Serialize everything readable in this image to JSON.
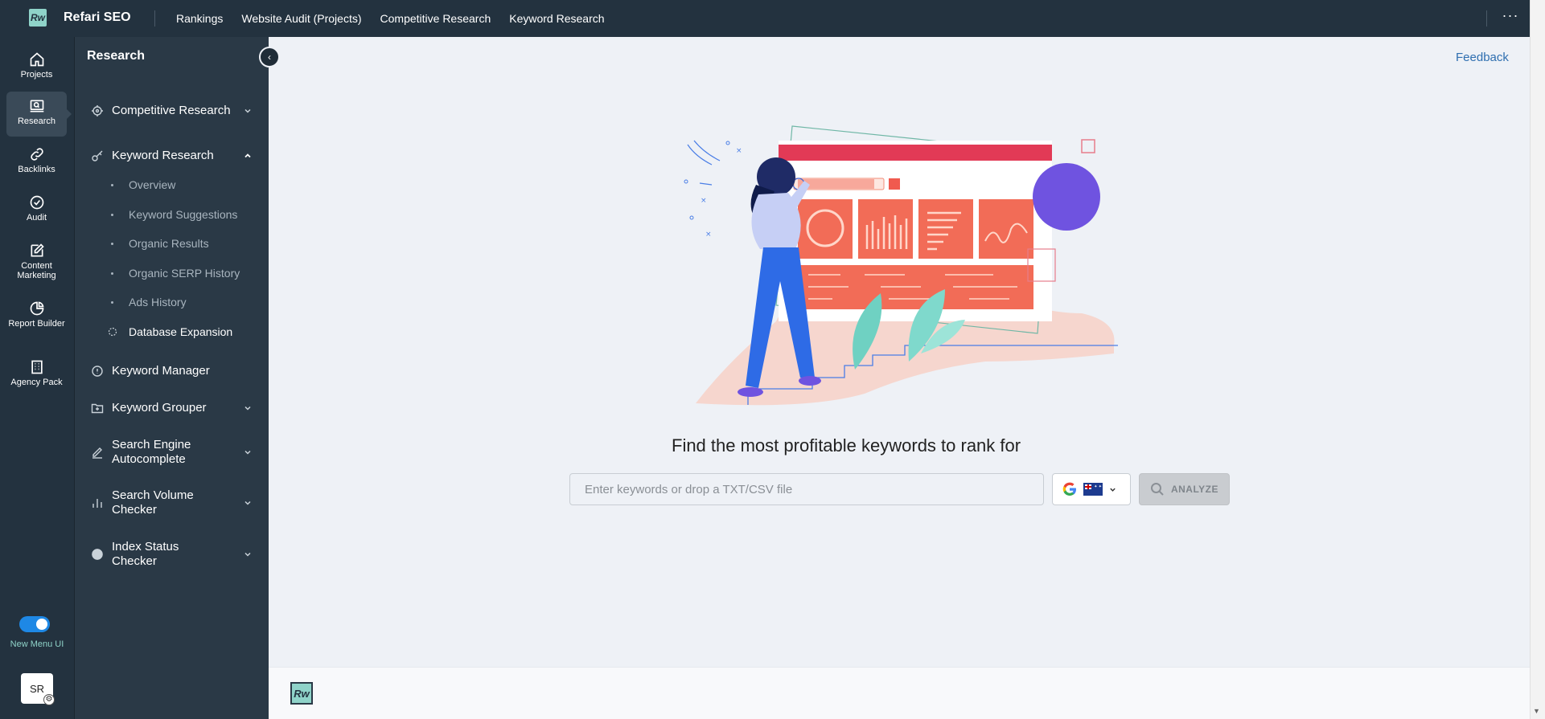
{
  "app": {
    "brand": "Refari SEO",
    "logo_text": "Rw"
  },
  "topnav": {
    "items": [
      "Rankings",
      "Website Audit (Projects)",
      "Competitive Research",
      "Keyword Research"
    ],
    "more_icon": "more-dots-icon"
  },
  "rail": {
    "items": [
      {
        "label": "Projects",
        "icon": "home-icon"
      },
      {
        "label": "Research",
        "icon": "research-icon"
      },
      {
        "label": "Backlinks",
        "icon": "link-icon"
      },
      {
        "label": "Audit",
        "icon": "check-circle-icon"
      },
      {
        "label": "Content Marketing",
        "icon": "edit-icon"
      },
      {
        "label": "Report Builder",
        "icon": "pie-chart-icon"
      },
      {
        "label": "Agency Pack",
        "icon": "building-icon"
      }
    ],
    "active": "Research",
    "toggle_label": "New Menu UI",
    "toggle_on": true,
    "avatar_initials": "SR"
  },
  "sidebar": {
    "title": "Research",
    "items": [
      {
        "label": "Competitive Research",
        "icon": "target-icon",
        "expanded": false
      },
      {
        "label": "Keyword Research",
        "icon": "key-icon",
        "expanded": true
      },
      {
        "label": "Keyword Manager",
        "icon": "info-circle-icon"
      },
      {
        "label": "Keyword Grouper",
        "icon": "folder-plus-icon",
        "expanded": false
      },
      {
        "label": "Search Engine Autocomplete",
        "icon": "pencil-icon",
        "expanded": false
      },
      {
        "label": "Search Volume Checker",
        "icon": "bar-chart-icon",
        "expanded": false
      },
      {
        "label": "Index Status Checker",
        "icon": "index-icon",
        "expanded": false
      }
    ],
    "keyword_research_subitems": [
      "Overview",
      "Keyword Suggestions",
      "Organic Results",
      "Organic SERP History",
      "Ads History",
      "Database Expansion"
    ]
  },
  "main": {
    "feedback": "Feedback",
    "headline": "Find the most profitable keywords to rank for",
    "search_placeholder": "Enter keywords or drop a TXT/CSV file",
    "analyze_label": "ANALYZE",
    "engine_icon": "google-icon",
    "country_flag": "australia-flag-icon"
  },
  "footer": {
    "logo_text": "Rw"
  }
}
